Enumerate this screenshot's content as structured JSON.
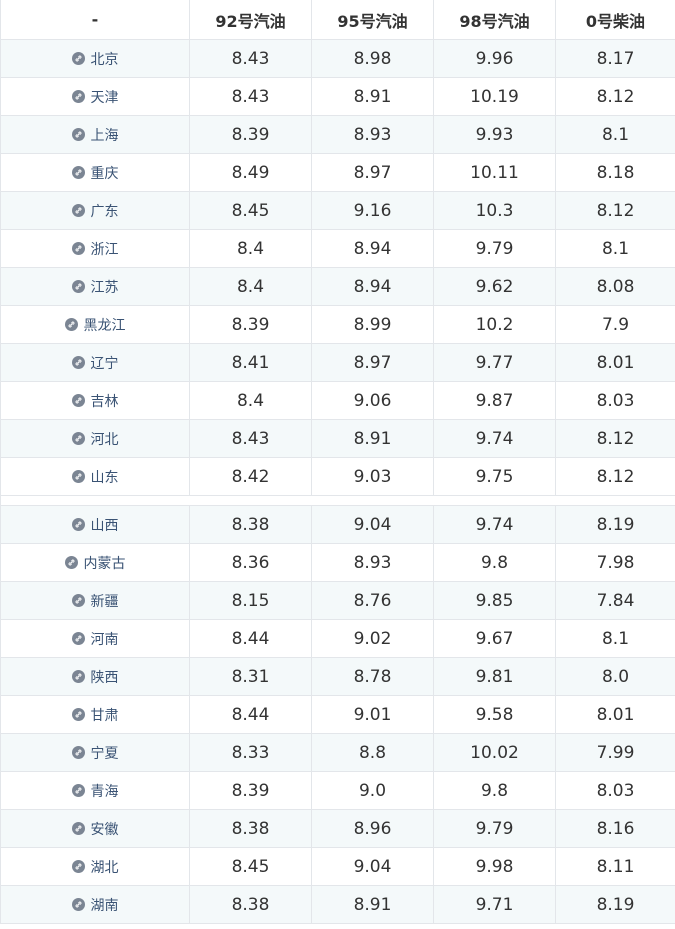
{
  "header": {
    "col0": "-",
    "col1": "92号汽油",
    "col2": "95号汽油",
    "col3": "98号汽油",
    "col4": "0号柴油"
  },
  "group1": [
    {
      "region": "北京",
      "p92": "8.43",
      "p95": "8.98",
      "p98": "9.96",
      "d0": "8.17"
    },
    {
      "region": "天津",
      "p92": "8.43",
      "p95": "8.91",
      "p98": "10.19",
      "d0": "8.12"
    },
    {
      "region": "上海",
      "p92": "8.39",
      "p95": "8.93",
      "p98": "9.93",
      "d0": "8.1"
    },
    {
      "region": "重庆",
      "p92": "8.49",
      "p95": "8.97",
      "p98": "10.11",
      "d0": "8.18"
    },
    {
      "region": "广东",
      "p92": "8.45",
      "p95": "9.16",
      "p98": "10.3",
      "d0": "8.12"
    },
    {
      "region": "浙江",
      "p92": "8.4",
      "p95": "8.94",
      "p98": "9.79",
      "d0": "8.1"
    },
    {
      "region": "江苏",
      "p92": "8.4",
      "p95": "8.94",
      "p98": "9.62",
      "d0": "8.08"
    },
    {
      "region": "黑龙江",
      "p92": "8.39",
      "p95": "8.99",
      "p98": "10.2",
      "d0": "7.9"
    },
    {
      "region": "辽宁",
      "p92": "8.41",
      "p95": "8.97",
      "p98": "9.77",
      "d0": "8.01"
    },
    {
      "region": "吉林",
      "p92": "8.4",
      "p95": "9.06",
      "p98": "9.87",
      "d0": "8.03"
    },
    {
      "region": "河北",
      "p92": "8.43",
      "p95": "8.91",
      "p98": "9.74",
      "d0": "8.12"
    },
    {
      "region": "山东",
      "p92": "8.42",
      "p95": "9.03",
      "p98": "9.75",
      "d0": "8.12"
    }
  ],
  "group2": [
    {
      "region": "山西",
      "p92": "8.38",
      "p95": "9.04",
      "p98": "9.74",
      "d0": "8.19"
    },
    {
      "region": "内蒙古",
      "p92": "8.36",
      "p95": "8.93",
      "p98": "9.8",
      "d0": "7.98"
    },
    {
      "region": "新疆",
      "p92": "8.15",
      "p95": "8.76",
      "p98": "9.85",
      "d0": "7.84"
    },
    {
      "region": "河南",
      "p92": "8.44",
      "p95": "9.02",
      "p98": "9.67",
      "d0": "8.1"
    },
    {
      "region": "陕西",
      "p92": "8.31",
      "p95": "8.78",
      "p98": "9.81",
      "d0": "8.0"
    },
    {
      "region": "甘肃",
      "p92": "8.44",
      "p95": "9.01",
      "p98": "9.58",
      "d0": "8.01"
    },
    {
      "region": "宁夏",
      "p92": "8.33",
      "p95": "8.8",
      "p98": "10.02",
      "d0": "7.99"
    },
    {
      "region": "青海",
      "p92": "8.39",
      "p95": "9.0",
      "p98": "9.8",
      "d0": "8.03"
    },
    {
      "region": "安徽",
      "p92": "8.38",
      "p95": "8.96",
      "p98": "9.79",
      "d0": "8.16"
    },
    {
      "region": "湖北",
      "p92": "8.45",
      "p95": "9.04",
      "p98": "9.98",
      "d0": "8.11"
    },
    {
      "region": "湖南",
      "p92": "8.38",
      "p95": "8.91",
      "p98": "9.71",
      "d0": "8.19"
    }
  ],
  "icons": {
    "region_link": "link-icon"
  },
  "colors": {
    "stripe": "#f4f9fa",
    "border": "#e3e6ea",
    "link": "#3a5374",
    "icon_bg": "#7b8593"
  }
}
